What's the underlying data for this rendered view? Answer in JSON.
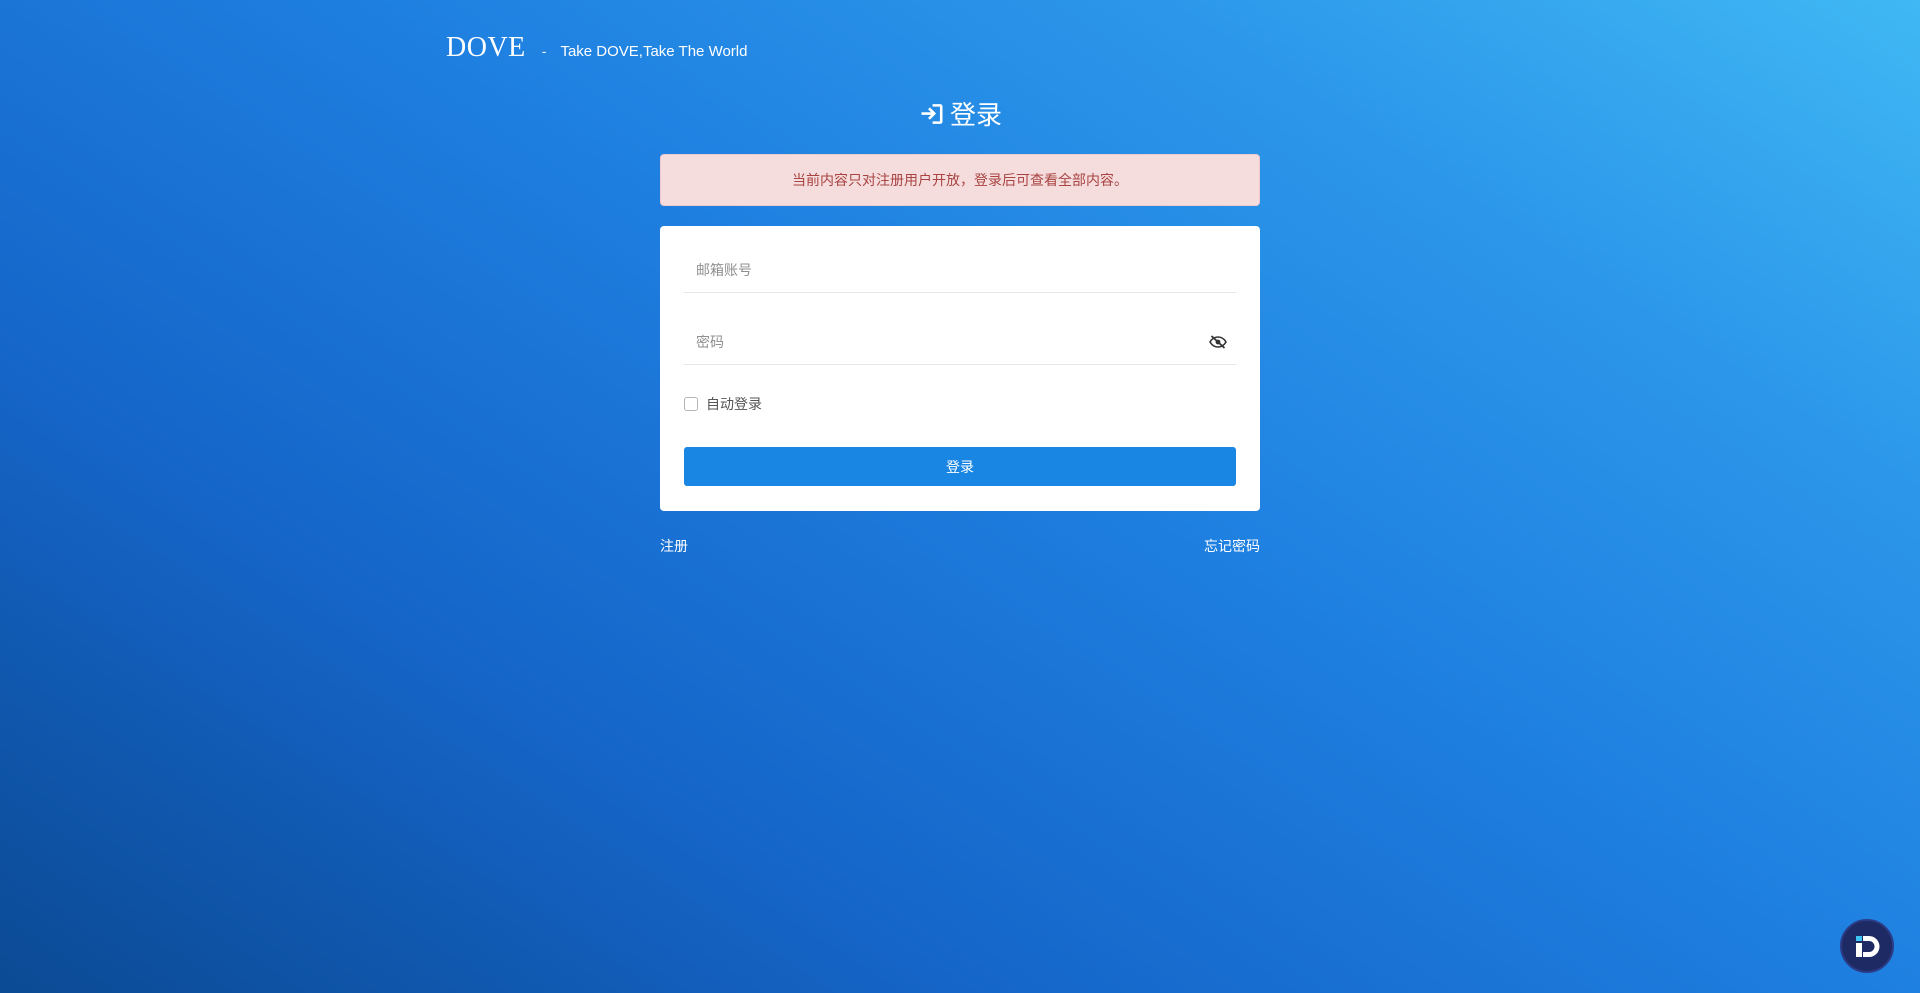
{
  "brand": {
    "name": "DOVE",
    "separator": "-",
    "slogan": "Take DOVE,Take The World"
  },
  "heading": {
    "title": "登录",
    "icon": "sign-in-icon"
  },
  "alert": {
    "message": "当前内容只对注册用户开放，登录后可查看全部内容。"
  },
  "form": {
    "email": {
      "value": "",
      "placeholder": "邮箱账号"
    },
    "password": {
      "value": "",
      "placeholder": "密码",
      "toggle_icon": "eye-slash-icon"
    },
    "remember": {
      "label": "自动登录",
      "checked": false
    },
    "submit_label": "登录"
  },
  "links": {
    "register": "注册",
    "forgot": "忘记密码"
  },
  "colors": {
    "primary_button": "#1a86e3",
    "alert_bg": "#f5dcdd",
    "alert_text": "#a94442",
    "badge_bg": "#1e2a63"
  },
  "badge": {
    "icon": "app-logo-icon"
  }
}
